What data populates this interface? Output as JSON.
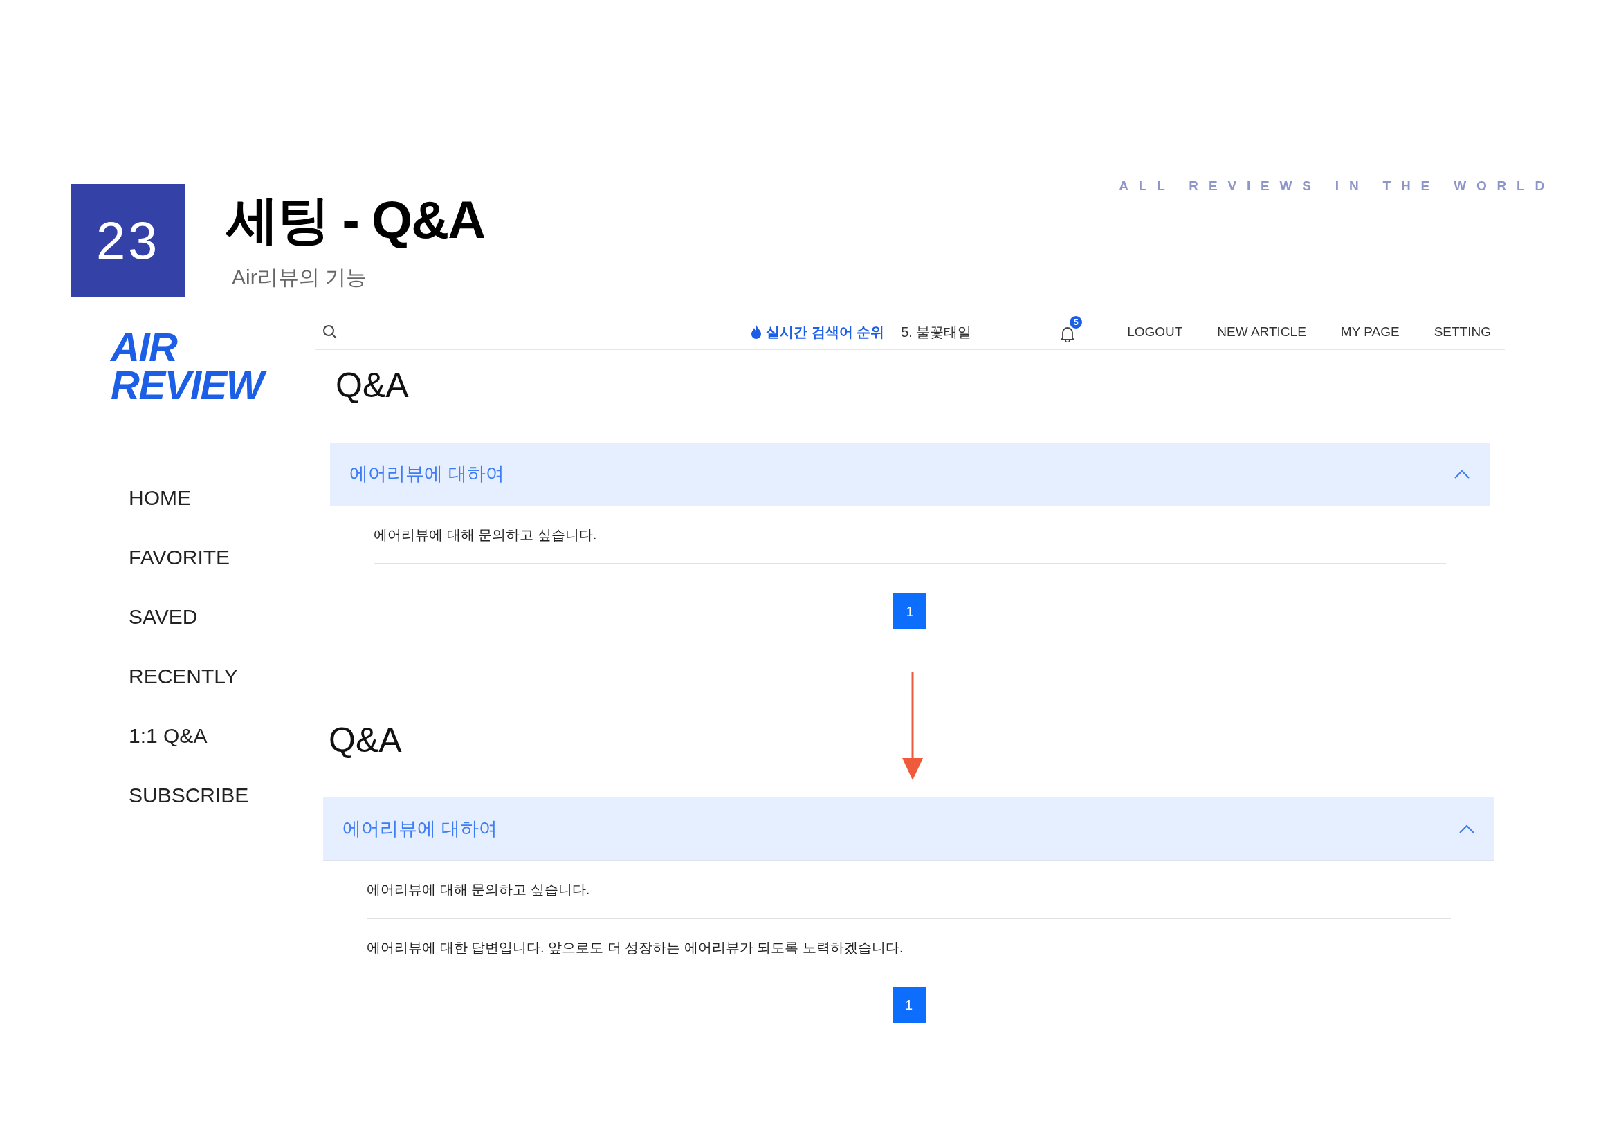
{
  "slide": {
    "number": "23",
    "title": "세팅 - Q&A",
    "subtitle": "Air리뷰의 기능",
    "tagline": "ALL REVIEWS IN THE WORLD"
  },
  "sidebar": {
    "logo": [
      "AIR",
      "REVIEW"
    ],
    "items": [
      "HOME",
      "FAVORITE",
      "SAVED",
      "RECENTLY",
      "1:1 Q&A",
      "SUBSCRIBE"
    ]
  },
  "topbar": {
    "trending_label": "실시간 검색어 순위",
    "trending_item": "5. 불꽃태일",
    "notification_count": "5",
    "links": [
      "LOGOUT",
      "NEW ARTICLE",
      "MY PAGE",
      "SETTING"
    ]
  },
  "sections": [
    {
      "title": "Q&A",
      "accordion": {
        "title": "에어리뷰에 대하여",
        "expanded": true,
        "question": "에어리뷰에 대해 문의하고 싶습니다."
      },
      "pages": [
        {
          "label": "1",
          "selected": true
        }
      ]
    },
    {
      "title": "Q&A",
      "accordion": {
        "title": "에어리뷰에 대하여",
        "expanded": true,
        "question": "에어리뷰에 대해 문의하고 싶습니다.",
        "answer": "에어리뷰에 대한 답변입니다. 앞으로도 더 성장하는 에어리뷰가 되도록 노력하겠습니다."
      },
      "pages": [
        {
          "label": "1",
          "selected": true
        }
      ]
    }
  ]
}
